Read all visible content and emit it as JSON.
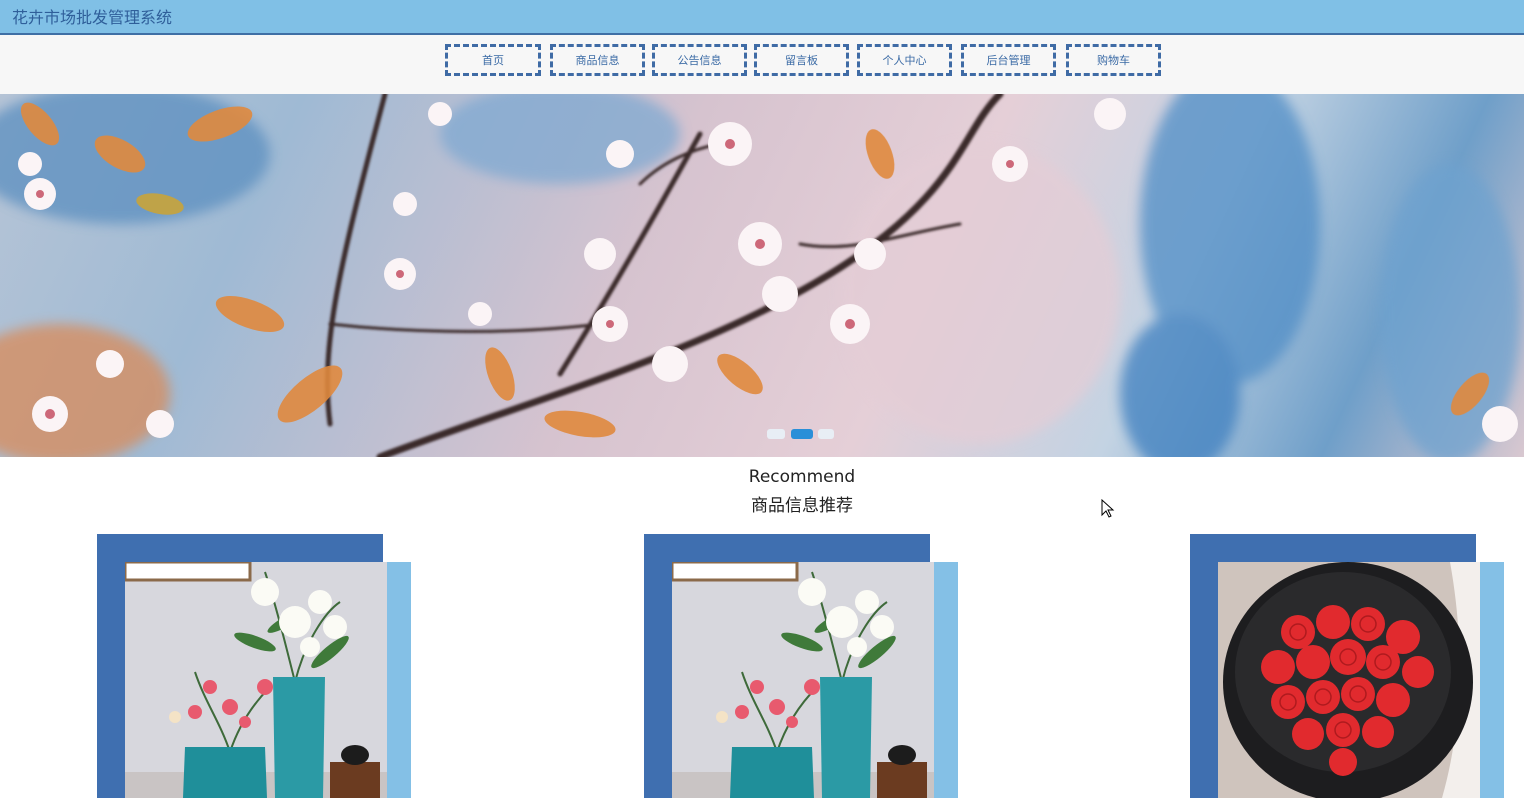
{
  "header": {
    "title": "花卉市场批发管理系统"
  },
  "nav": {
    "items": [
      {
        "label": "首页"
      },
      {
        "label": "商品信息"
      },
      {
        "label": "公告信息"
      },
      {
        "label": "留言板"
      },
      {
        "label": "个人中心"
      },
      {
        "label": "后台管理"
      },
      {
        "label": "购物车"
      }
    ]
  },
  "banner": {
    "slides": 3,
    "active_slide": 2
  },
  "recommend": {
    "title_en": "Recommend",
    "title_cn": "商品信息推荐"
  },
  "colors": {
    "header_bg": "#80c0e6",
    "accent_blue": "#3f6fb0",
    "light_blue": "#84c0e6",
    "nav_border": "#3f6ba5"
  }
}
